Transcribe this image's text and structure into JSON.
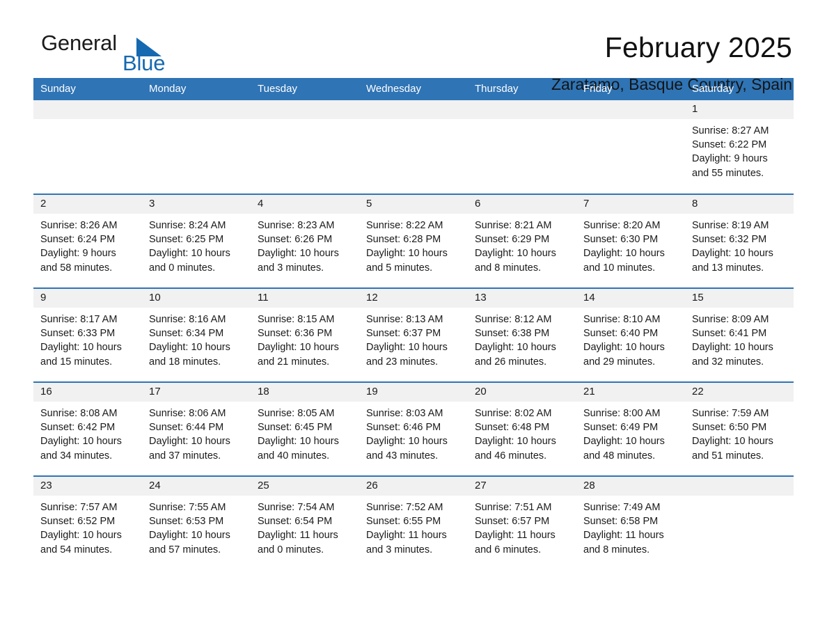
{
  "brand": {
    "word_one": "General",
    "word_two": "Blue",
    "triangle_color": "#1569b0"
  },
  "header": {
    "month_title": "February 2025",
    "location": "Zaratamo, Basque Country, Spain"
  },
  "theme": {
    "header_blue": "#2f74b5",
    "daynum_gray": "#f1f1f1",
    "text": "#1a1a1a"
  },
  "weekday_headers": [
    "Sunday",
    "Monday",
    "Tuesday",
    "Wednesday",
    "Thursday",
    "Friday",
    "Saturday"
  ],
  "labels": {
    "sunrise_prefix": "Sunrise:",
    "sunset_prefix": "Sunset:",
    "daylight_prefix": "Daylight:"
  },
  "weeks": [
    [
      {
        "day": "",
        "empty": true,
        "sunrise": "",
        "sunset": "",
        "daylight_l1": "",
        "daylight_l2": ""
      },
      {
        "day": "",
        "empty": true,
        "sunrise": "",
        "sunset": "",
        "daylight_l1": "",
        "daylight_l2": ""
      },
      {
        "day": "",
        "empty": true,
        "sunrise": "",
        "sunset": "",
        "daylight_l1": "",
        "daylight_l2": ""
      },
      {
        "day": "",
        "empty": true,
        "sunrise": "",
        "sunset": "",
        "daylight_l1": "",
        "daylight_l2": ""
      },
      {
        "day": "",
        "empty": true,
        "sunrise": "",
        "sunset": "",
        "daylight_l1": "",
        "daylight_l2": ""
      },
      {
        "day": "",
        "empty": true,
        "sunrise": "",
        "sunset": "",
        "daylight_l1": "",
        "daylight_l2": ""
      },
      {
        "day": "1",
        "empty": false,
        "sunrise": "Sunrise: 8:27 AM",
        "sunset": "Sunset: 6:22 PM",
        "daylight_l1": "Daylight: 9 hours",
        "daylight_l2": "and 55 minutes."
      }
    ],
    [
      {
        "day": "2",
        "empty": false,
        "sunrise": "Sunrise: 8:26 AM",
        "sunset": "Sunset: 6:24 PM",
        "daylight_l1": "Daylight: 9 hours",
        "daylight_l2": "and 58 minutes."
      },
      {
        "day": "3",
        "empty": false,
        "sunrise": "Sunrise: 8:24 AM",
        "sunset": "Sunset: 6:25 PM",
        "daylight_l1": "Daylight: 10 hours",
        "daylight_l2": "and 0 minutes."
      },
      {
        "day": "4",
        "empty": false,
        "sunrise": "Sunrise: 8:23 AM",
        "sunset": "Sunset: 6:26 PM",
        "daylight_l1": "Daylight: 10 hours",
        "daylight_l2": "and 3 minutes."
      },
      {
        "day": "5",
        "empty": false,
        "sunrise": "Sunrise: 8:22 AM",
        "sunset": "Sunset: 6:28 PM",
        "daylight_l1": "Daylight: 10 hours",
        "daylight_l2": "and 5 minutes."
      },
      {
        "day": "6",
        "empty": false,
        "sunrise": "Sunrise: 8:21 AM",
        "sunset": "Sunset: 6:29 PM",
        "daylight_l1": "Daylight: 10 hours",
        "daylight_l2": "and 8 minutes."
      },
      {
        "day": "7",
        "empty": false,
        "sunrise": "Sunrise: 8:20 AM",
        "sunset": "Sunset: 6:30 PM",
        "daylight_l1": "Daylight: 10 hours",
        "daylight_l2": "and 10 minutes."
      },
      {
        "day": "8",
        "empty": false,
        "sunrise": "Sunrise: 8:19 AM",
        "sunset": "Sunset: 6:32 PM",
        "daylight_l1": "Daylight: 10 hours",
        "daylight_l2": "and 13 minutes."
      }
    ],
    [
      {
        "day": "9",
        "empty": false,
        "sunrise": "Sunrise: 8:17 AM",
        "sunset": "Sunset: 6:33 PM",
        "daylight_l1": "Daylight: 10 hours",
        "daylight_l2": "and 15 minutes."
      },
      {
        "day": "10",
        "empty": false,
        "sunrise": "Sunrise: 8:16 AM",
        "sunset": "Sunset: 6:34 PM",
        "daylight_l1": "Daylight: 10 hours",
        "daylight_l2": "and 18 minutes."
      },
      {
        "day": "11",
        "empty": false,
        "sunrise": "Sunrise: 8:15 AM",
        "sunset": "Sunset: 6:36 PM",
        "daylight_l1": "Daylight: 10 hours",
        "daylight_l2": "and 21 minutes."
      },
      {
        "day": "12",
        "empty": false,
        "sunrise": "Sunrise: 8:13 AM",
        "sunset": "Sunset: 6:37 PM",
        "daylight_l1": "Daylight: 10 hours",
        "daylight_l2": "and 23 minutes."
      },
      {
        "day": "13",
        "empty": false,
        "sunrise": "Sunrise: 8:12 AM",
        "sunset": "Sunset: 6:38 PM",
        "daylight_l1": "Daylight: 10 hours",
        "daylight_l2": "and 26 minutes."
      },
      {
        "day": "14",
        "empty": false,
        "sunrise": "Sunrise: 8:10 AM",
        "sunset": "Sunset: 6:40 PM",
        "daylight_l1": "Daylight: 10 hours",
        "daylight_l2": "and 29 minutes."
      },
      {
        "day": "15",
        "empty": false,
        "sunrise": "Sunrise: 8:09 AM",
        "sunset": "Sunset: 6:41 PM",
        "daylight_l1": "Daylight: 10 hours",
        "daylight_l2": "and 32 minutes."
      }
    ],
    [
      {
        "day": "16",
        "empty": false,
        "sunrise": "Sunrise: 8:08 AM",
        "sunset": "Sunset: 6:42 PM",
        "daylight_l1": "Daylight: 10 hours",
        "daylight_l2": "and 34 minutes."
      },
      {
        "day": "17",
        "empty": false,
        "sunrise": "Sunrise: 8:06 AM",
        "sunset": "Sunset: 6:44 PM",
        "daylight_l1": "Daylight: 10 hours",
        "daylight_l2": "and 37 minutes."
      },
      {
        "day": "18",
        "empty": false,
        "sunrise": "Sunrise: 8:05 AM",
        "sunset": "Sunset: 6:45 PM",
        "daylight_l1": "Daylight: 10 hours",
        "daylight_l2": "and 40 minutes."
      },
      {
        "day": "19",
        "empty": false,
        "sunrise": "Sunrise: 8:03 AM",
        "sunset": "Sunset: 6:46 PM",
        "daylight_l1": "Daylight: 10 hours",
        "daylight_l2": "and 43 minutes."
      },
      {
        "day": "20",
        "empty": false,
        "sunrise": "Sunrise: 8:02 AM",
        "sunset": "Sunset: 6:48 PM",
        "daylight_l1": "Daylight: 10 hours",
        "daylight_l2": "and 46 minutes."
      },
      {
        "day": "21",
        "empty": false,
        "sunrise": "Sunrise: 8:00 AM",
        "sunset": "Sunset: 6:49 PM",
        "daylight_l1": "Daylight: 10 hours",
        "daylight_l2": "and 48 minutes."
      },
      {
        "day": "22",
        "empty": false,
        "sunrise": "Sunrise: 7:59 AM",
        "sunset": "Sunset: 6:50 PM",
        "daylight_l1": "Daylight: 10 hours",
        "daylight_l2": "and 51 minutes."
      }
    ],
    [
      {
        "day": "23",
        "empty": false,
        "sunrise": "Sunrise: 7:57 AM",
        "sunset": "Sunset: 6:52 PM",
        "daylight_l1": "Daylight: 10 hours",
        "daylight_l2": "and 54 minutes."
      },
      {
        "day": "24",
        "empty": false,
        "sunrise": "Sunrise: 7:55 AM",
        "sunset": "Sunset: 6:53 PM",
        "daylight_l1": "Daylight: 10 hours",
        "daylight_l2": "and 57 minutes."
      },
      {
        "day": "25",
        "empty": false,
        "sunrise": "Sunrise: 7:54 AM",
        "sunset": "Sunset: 6:54 PM",
        "daylight_l1": "Daylight: 11 hours",
        "daylight_l2": "and 0 minutes."
      },
      {
        "day": "26",
        "empty": false,
        "sunrise": "Sunrise: 7:52 AM",
        "sunset": "Sunset: 6:55 PM",
        "daylight_l1": "Daylight: 11 hours",
        "daylight_l2": "and 3 minutes."
      },
      {
        "day": "27",
        "empty": false,
        "sunrise": "Sunrise: 7:51 AM",
        "sunset": "Sunset: 6:57 PM",
        "daylight_l1": "Daylight: 11 hours",
        "daylight_l2": "and 6 minutes."
      },
      {
        "day": "28",
        "empty": false,
        "sunrise": "Sunrise: 7:49 AM",
        "sunset": "Sunset: 6:58 PM",
        "daylight_l1": "Daylight: 11 hours",
        "daylight_l2": "and 8 minutes."
      },
      {
        "day": "",
        "empty": true,
        "sunrise": "",
        "sunset": "",
        "daylight_l1": "",
        "daylight_l2": ""
      }
    ]
  ]
}
